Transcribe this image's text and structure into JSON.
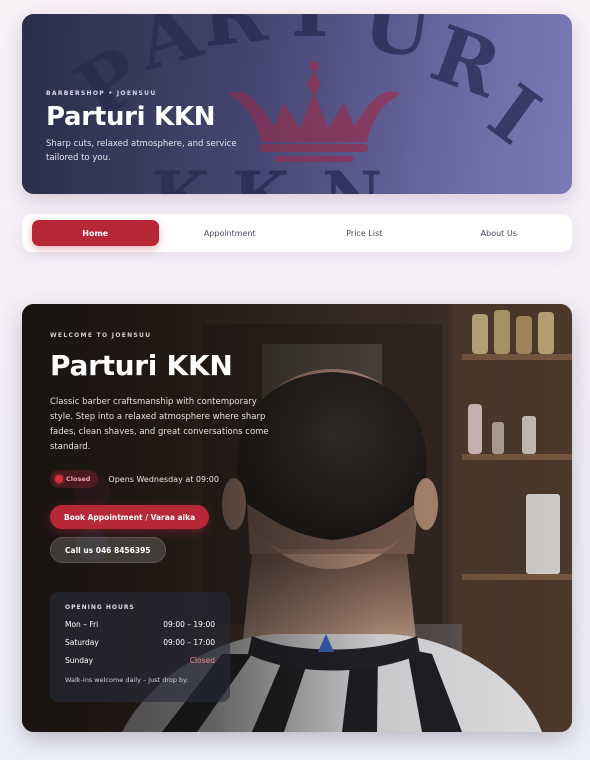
{
  "header": {
    "kicker": "BARBERSHOP • JOENSUU",
    "title": "Parturi KKN",
    "subtitle": "Sharp cuts, relaxed atmosphere, and service tailored to you.",
    "logo_letters_top": "PARTURI",
    "logo_letters_bottom": "KKN"
  },
  "nav": {
    "tabs": [
      {
        "label": "Home",
        "active": true
      },
      {
        "label": "Appointment",
        "active": false
      },
      {
        "label": "Price List",
        "active": false
      },
      {
        "label": "About Us",
        "active": false
      }
    ]
  },
  "hero": {
    "kicker": "WELCOME TO JOENSUU",
    "title": "Parturi KKN",
    "description": "Classic barber craftsmanship with contemporary style. Step into a relaxed atmosphere where sharp fades, clean shaves, and great conversations come standard.",
    "status_badge": "Closed",
    "status_text": "Opens Wednesday at 09:00",
    "book_button": "Book Appointment / Varaa aika",
    "call_button": "Call us 046 8456395"
  },
  "hours": {
    "title": "OPENING HOURS",
    "rows": [
      {
        "day": "Mon – Fri",
        "time": "09:00 – 19:00"
      },
      {
        "day": "Saturday",
        "time": "09:00 – 17:00"
      },
      {
        "day": "Sunday",
        "time": "Closed"
      }
    ],
    "note": "Walk-ins welcome daily – just drop by."
  },
  "colors": {
    "accent": "#b72836",
    "header_bg": "#4b4d7c",
    "closed_text": "#f08a93"
  }
}
